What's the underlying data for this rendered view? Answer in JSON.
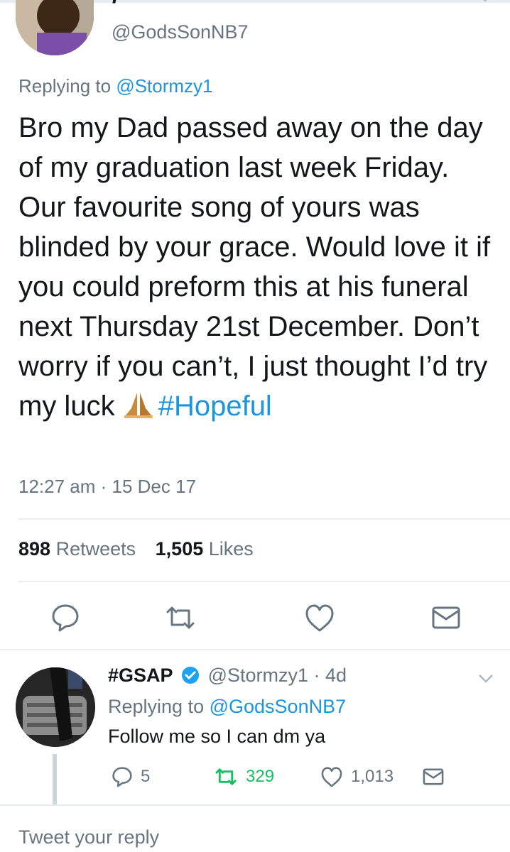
{
  "tweet": {
    "name_partial": "/",
    "handle": "@GodsSonNB7",
    "replying_prefix": "Replying to",
    "replying_to": "@Stormzy1",
    "text": "Bro my Dad passed away on the day of my graduation last week Friday. Our favourite song of yours was blinded by your grace. Would love it if you could preform this at his funeral next Thursday 21st December. Don’t worry if you can’t, I just thought I’d try my luck",
    "hashtag": "#Hopeful",
    "timestamp": "12:27 am · 15 Dec 17",
    "retweets_count": "898",
    "retweets_label": "Retweets",
    "likes_count": "1,505",
    "likes_label": "Likes",
    "icons": [
      "reply-icon",
      "retweet-icon",
      "like-icon",
      "share-icon"
    ]
  },
  "reply": {
    "name": "#GSAP",
    "handle": "@Stormzy1",
    "separator": " · ",
    "age": "4d",
    "replying_prefix": "Replying to",
    "replying_to": "@GodsSonNB7",
    "text": "Follow me so I can dm ya",
    "reply_count": "5",
    "retweet_count": "329",
    "like_count": "1,013"
  },
  "composer": {
    "placeholder": "Tweet your reply"
  },
  "colors": {
    "accent": "#1b95e0",
    "muted": "#66757f",
    "retweet_active": "#17bf63",
    "border": "#e6ecf0",
    "verified": "#1da1f2"
  }
}
